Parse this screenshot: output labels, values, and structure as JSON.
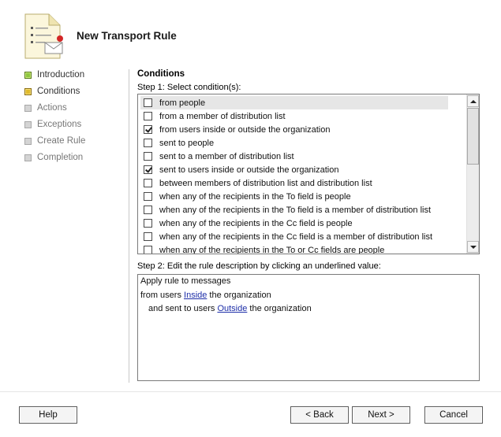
{
  "wizard": {
    "title": "New Transport Rule",
    "header_icon": "document-rule-icon"
  },
  "steps": [
    {
      "label": "Introduction",
      "state": "done"
    },
    {
      "label": "Conditions",
      "state": "current"
    },
    {
      "label": "Actions",
      "state": "pending"
    },
    {
      "label": "Exceptions",
      "state": "pending"
    },
    {
      "label": "Create Rule",
      "state": "pending"
    },
    {
      "label": "Completion",
      "state": "pending"
    }
  ],
  "content": {
    "section_title": "Conditions",
    "step1_label": "Step 1: Select condition(s):",
    "conditions": [
      {
        "label": "from people",
        "checked": false,
        "highlighted": true
      },
      {
        "label": "from a member of distribution list",
        "checked": false
      },
      {
        "label": "from users inside or outside the organization",
        "checked": true
      },
      {
        "label": "sent to people",
        "checked": false
      },
      {
        "label": "sent to a member of distribution list",
        "checked": false
      },
      {
        "label": "sent to users inside or outside the organization",
        "checked": true
      },
      {
        "label": "between members of distribution list and distribution list",
        "checked": false
      },
      {
        "label": "when any of the recipients in the To field is people",
        "checked": false
      },
      {
        "label": "when any of the recipients in the To field is a member of distribution list",
        "checked": false
      },
      {
        "label": "when any of the recipients in the Cc field is people",
        "checked": false
      },
      {
        "label": "when any of the recipients in the Cc field is a member of distribution list",
        "checked": false
      },
      {
        "label": "when any of the recipients in the To or Cc fields are people",
        "checked": false
      }
    ],
    "step2_label": "Step 2: Edit the rule description by clicking an underlined value:",
    "description": {
      "line1": "Apply rule to messages",
      "line2_prefix": "from users ",
      "line2_link": "Inside",
      "line2_suffix": " the organization",
      "line3_prefix": "and sent to users ",
      "line3_link": "Outside",
      "line3_suffix": " the organization"
    }
  },
  "buttons": {
    "help": "Help",
    "back": "< Back",
    "next": "Next >",
    "cancel": "Cancel"
  }
}
